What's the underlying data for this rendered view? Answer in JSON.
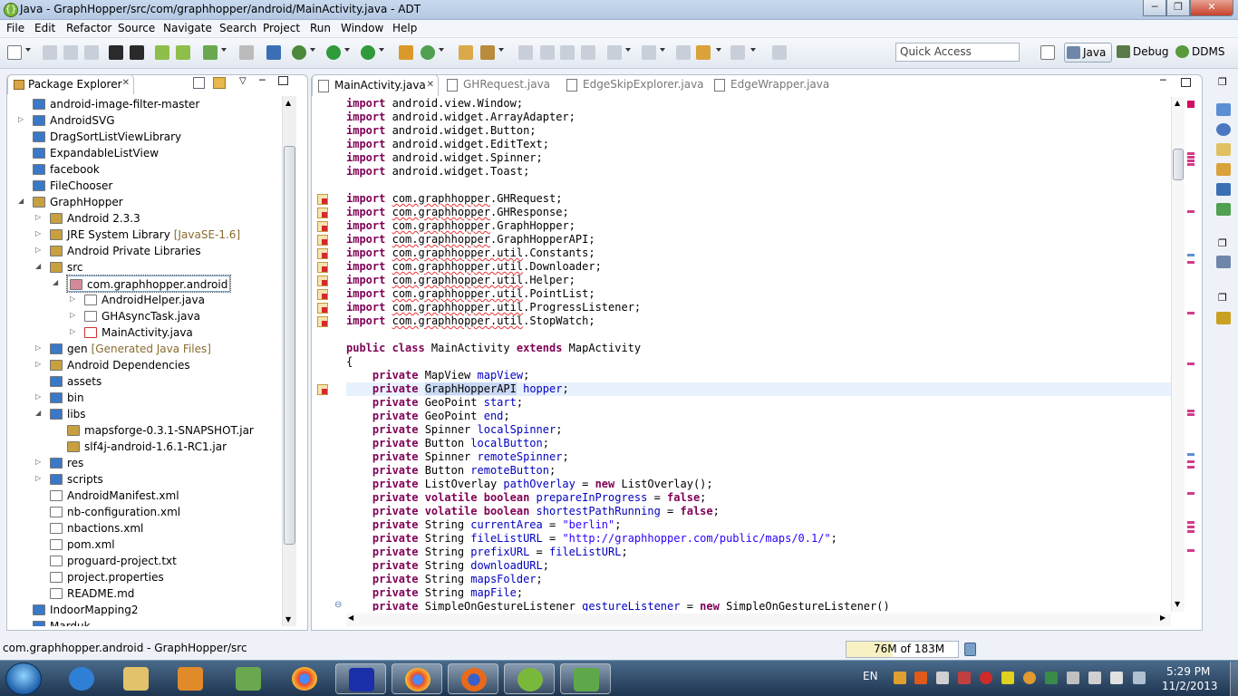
{
  "window": {
    "title": "Java - GraphHopper/src/com/graphhopper/android/MainActivity.java - ADT"
  },
  "menu": [
    "File",
    "Edit",
    "Refactor",
    "Source",
    "Navigate",
    "Search",
    "Project",
    "Run",
    "Window",
    "Help"
  ],
  "toolbar": {
    "quick_access_placeholder": "Quick Access"
  },
  "perspectives": [
    "Java",
    "Debug",
    "DDMS"
  ],
  "package_explorer": {
    "title": "Package Explorer",
    "items": [
      {
        "label": "android-image-filter-master",
        "decor": ""
      },
      {
        "label": "AndroidSVG",
        "decor": ""
      },
      {
        "label": "DragSortListViewLibrary",
        "decor": ""
      },
      {
        "label": "ExpandableListView",
        "decor": ""
      },
      {
        "label": "facebook",
        "decor": ""
      },
      {
        "label": "FileChooser",
        "decor": ""
      },
      {
        "label": "GraphHopper",
        "decor": ""
      },
      {
        "label": "Android 2.3.3",
        "decor": ""
      },
      {
        "label": "JRE System Library",
        "decor": "[JavaSE-1.6]"
      },
      {
        "label": "Android Private Libraries",
        "decor": ""
      },
      {
        "label": "src",
        "decor": ""
      },
      {
        "label": "com.graphhopper.android",
        "decor": ""
      },
      {
        "label": "AndroidHelper.java",
        "decor": ""
      },
      {
        "label": "GHAsyncTask.java",
        "decor": ""
      },
      {
        "label": "MainActivity.java",
        "decor": ""
      },
      {
        "label": "gen",
        "decor": "[Generated Java Files]"
      },
      {
        "label": "Android Dependencies",
        "decor": ""
      },
      {
        "label": "assets",
        "decor": ""
      },
      {
        "label": "bin",
        "decor": ""
      },
      {
        "label": "libs",
        "decor": ""
      },
      {
        "label": "mapsforge-0.3.1-SNAPSHOT.jar",
        "decor": ""
      },
      {
        "label": "slf4j-android-1.6.1-RC1.jar",
        "decor": ""
      },
      {
        "label": "res",
        "decor": ""
      },
      {
        "label": "scripts",
        "decor": ""
      },
      {
        "label": "AndroidManifest.xml",
        "decor": ""
      },
      {
        "label": "nb-configuration.xml",
        "decor": ""
      },
      {
        "label": "nbactions.xml",
        "decor": ""
      },
      {
        "label": "pom.xml",
        "decor": ""
      },
      {
        "label": "proguard-project.txt",
        "decor": ""
      },
      {
        "label": "project.properties",
        "decor": ""
      },
      {
        "label": "README.md",
        "decor": ""
      },
      {
        "label": "IndoorMapping2",
        "decor": ""
      },
      {
        "label": "Marduk",
        "decor": ""
      }
    ]
  },
  "editor": {
    "tabs": [
      "MainActivity.java",
      "GHRequest.java",
      "EdgeSkipExplorer.java",
      "EdgeWrapper.java"
    ],
    "code": [
      [
        [
          "k",
          "import"
        ],
        [
          "t",
          " android.view.Window;"
        ]
      ],
      [
        [
          "k",
          "import"
        ],
        [
          "t",
          " android.widget.ArrayAdapter;"
        ]
      ],
      [
        [
          "k",
          "import"
        ],
        [
          "t",
          " android.widget.Button;"
        ]
      ],
      [
        [
          "k",
          "import"
        ],
        [
          "t",
          " android.widget.EditText;"
        ]
      ],
      [
        [
          "k",
          "import"
        ],
        [
          "t",
          " android.widget.Spinner;"
        ]
      ],
      [
        [
          "k",
          "import"
        ],
        [
          "t",
          " android.widget.Toast;"
        ]
      ],
      [],
      [
        [
          "k",
          "import"
        ],
        [
          "t",
          " "
        ],
        [
          "w",
          "com.graphhopper"
        ],
        [
          "t",
          ".GHRequest;"
        ]
      ],
      [
        [
          "k",
          "import"
        ],
        [
          "t",
          " "
        ],
        [
          "w",
          "com.graphhopper"
        ],
        [
          "t",
          ".GHResponse;"
        ]
      ],
      [
        [
          "k",
          "import"
        ],
        [
          "t",
          " "
        ],
        [
          "w",
          "com.graphhopper"
        ],
        [
          "t",
          ".GraphHopper;"
        ]
      ],
      [
        [
          "k",
          "import"
        ],
        [
          "t",
          " "
        ],
        [
          "w",
          "com.graphhopper"
        ],
        [
          "t",
          ".GraphHopperAPI;"
        ]
      ],
      [
        [
          "k",
          "import"
        ],
        [
          "t",
          " "
        ],
        [
          "w",
          "com.graphhopper.util"
        ],
        [
          "t",
          ".Constants;"
        ]
      ],
      [
        [
          "k",
          "import"
        ],
        [
          "t",
          " "
        ],
        [
          "w",
          "com.graphhopper.util"
        ],
        [
          "t",
          ".Downloader;"
        ]
      ],
      [
        [
          "k",
          "import"
        ],
        [
          "t",
          " "
        ],
        [
          "w",
          "com.graphhopper.util"
        ],
        [
          "t",
          ".Helper;"
        ]
      ],
      [
        [
          "k",
          "import"
        ],
        [
          "t",
          " "
        ],
        [
          "w",
          "com.graphhopper.util"
        ],
        [
          "t",
          ".PointList;"
        ]
      ],
      [
        [
          "k",
          "import"
        ],
        [
          "t",
          " "
        ],
        [
          "w",
          "com.graphhopper.util"
        ],
        [
          "t",
          ".ProgressListener;"
        ]
      ],
      [
        [
          "k",
          "import"
        ],
        [
          "t",
          " "
        ],
        [
          "w",
          "com.graphhopper.util"
        ],
        [
          "t",
          ".StopWatch;"
        ]
      ],
      [],
      [
        [
          "k",
          "public class"
        ],
        [
          "t",
          " MainActivity "
        ],
        [
          "k",
          "extends"
        ],
        [
          "t",
          " MapActivity"
        ]
      ],
      [
        [
          "t",
          "{"
        ]
      ],
      [
        [
          "t",
          "    "
        ],
        [
          "k",
          "private"
        ],
        [
          "t",
          " MapView "
        ],
        [
          "f",
          "mapView"
        ],
        [
          "t",
          ";"
        ]
      ],
      [
        [
          "t",
          "    "
        ],
        [
          "k",
          "private"
        ],
        [
          "t",
          " "
        ],
        [
          "h",
          "GraphHopperAPI"
        ],
        [
          "t",
          " "
        ],
        [
          "f",
          "hopper"
        ],
        [
          "t",
          ";"
        ]
      ],
      [
        [
          "t",
          "    "
        ],
        [
          "k",
          "private"
        ],
        [
          "t",
          " GeoPoint "
        ],
        [
          "f",
          "start"
        ],
        [
          "t",
          ";"
        ]
      ],
      [
        [
          "t",
          "    "
        ],
        [
          "k",
          "private"
        ],
        [
          "t",
          " GeoPoint "
        ],
        [
          "f",
          "end"
        ],
        [
          "t",
          ";"
        ]
      ],
      [
        [
          "t",
          "    "
        ],
        [
          "k",
          "private"
        ],
        [
          "t",
          " Spinner "
        ],
        [
          "f",
          "localSpinner"
        ],
        [
          "t",
          ";"
        ]
      ],
      [
        [
          "t",
          "    "
        ],
        [
          "k",
          "private"
        ],
        [
          "t",
          " Button "
        ],
        [
          "f",
          "localButton"
        ],
        [
          "t",
          ";"
        ]
      ],
      [
        [
          "t",
          "    "
        ],
        [
          "k",
          "private"
        ],
        [
          "t",
          " Spinner "
        ],
        [
          "f",
          "remoteSpinner"
        ],
        [
          "t",
          ";"
        ]
      ],
      [
        [
          "t",
          "    "
        ],
        [
          "k",
          "private"
        ],
        [
          "t",
          " Button "
        ],
        [
          "f",
          "remoteButton"
        ],
        [
          "t",
          ";"
        ]
      ],
      [
        [
          "t",
          "    "
        ],
        [
          "k",
          "private"
        ],
        [
          "t",
          " ListOverlay "
        ],
        [
          "f",
          "pathOverlay"
        ],
        [
          "t",
          " = "
        ],
        [
          "k",
          "new"
        ],
        [
          "t",
          " ListOverlay();"
        ]
      ],
      [
        [
          "t",
          "    "
        ],
        [
          "k",
          "private volatile boolean"
        ],
        [
          "t",
          " "
        ],
        [
          "f",
          "prepareInProgress"
        ],
        [
          "t",
          " = "
        ],
        [
          "k",
          "false"
        ],
        [
          "t",
          ";"
        ]
      ],
      [
        [
          "t",
          "    "
        ],
        [
          "k",
          "private volatile boolean"
        ],
        [
          "t",
          " "
        ],
        [
          "f",
          "shortestPathRunning"
        ],
        [
          "t",
          " = "
        ],
        [
          "k",
          "false"
        ],
        [
          "t",
          ";"
        ]
      ],
      [
        [
          "t",
          "    "
        ],
        [
          "k",
          "private"
        ],
        [
          "t",
          " String "
        ],
        [
          "f",
          "currentArea"
        ],
        [
          "t",
          " = "
        ],
        [
          "s",
          "\"berlin\""
        ],
        [
          "t",
          ";"
        ]
      ],
      [
        [
          "t",
          "    "
        ],
        [
          "k",
          "private"
        ],
        [
          "t",
          " String "
        ],
        [
          "f",
          "fileListURL"
        ],
        [
          "t",
          " = "
        ],
        [
          "s",
          "\"http://graphhopper.com/public/maps/0.1/\""
        ],
        [
          "t",
          ";"
        ]
      ],
      [
        [
          "t",
          "    "
        ],
        [
          "k",
          "private"
        ],
        [
          "t",
          " String "
        ],
        [
          "f",
          "prefixURL"
        ],
        [
          "t",
          " = "
        ],
        [
          "f",
          "fileListURL"
        ],
        [
          "t",
          ";"
        ]
      ],
      [
        [
          "t",
          "    "
        ],
        [
          "k",
          "private"
        ],
        [
          "t",
          " String "
        ],
        [
          "f",
          "downloadURL"
        ],
        [
          "t",
          ";"
        ]
      ],
      [
        [
          "t",
          "    "
        ],
        [
          "k",
          "private"
        ],
        [
          "t",
          " String "
        ],
        [
          "f",
          "mapsFolder"
        ],
        [
          "t",
          ";"
        ]
      ],
      [
        [
          "t",
          "    "
        ],
        [
          "k",
          "private"
        ],
        [
          "t",
          " String "
        ],
        [
          "f",
          "mapFile"
        ],
        [
          "t",
          ";"
        ]
      ],
      [
        [
          "t",
          "    "
        ],
        [
          "k",
          "private"
        ],
        [
          "t",
          " SimpleOnGestureListener "
        ],
        [
          "f",
          "gestureListener"
        ],
        [
          "t",
          " = "
        ],
        [
          "k",
          "new"
        ],
        [
          "t",
          " SimpleOnGestureListener()"
        ]
      ]
    ]
  },
  "status": {
    "text": "com.graphhopper.android - GraphHopper/src",
    "heap": "76M of 183M",
    "heap_fraction": 0.415
  },
  "taskbar": {
    "lang": "EN",
    "time": "5:29 PM",
    "date": "11/2/2013"
  }
}
